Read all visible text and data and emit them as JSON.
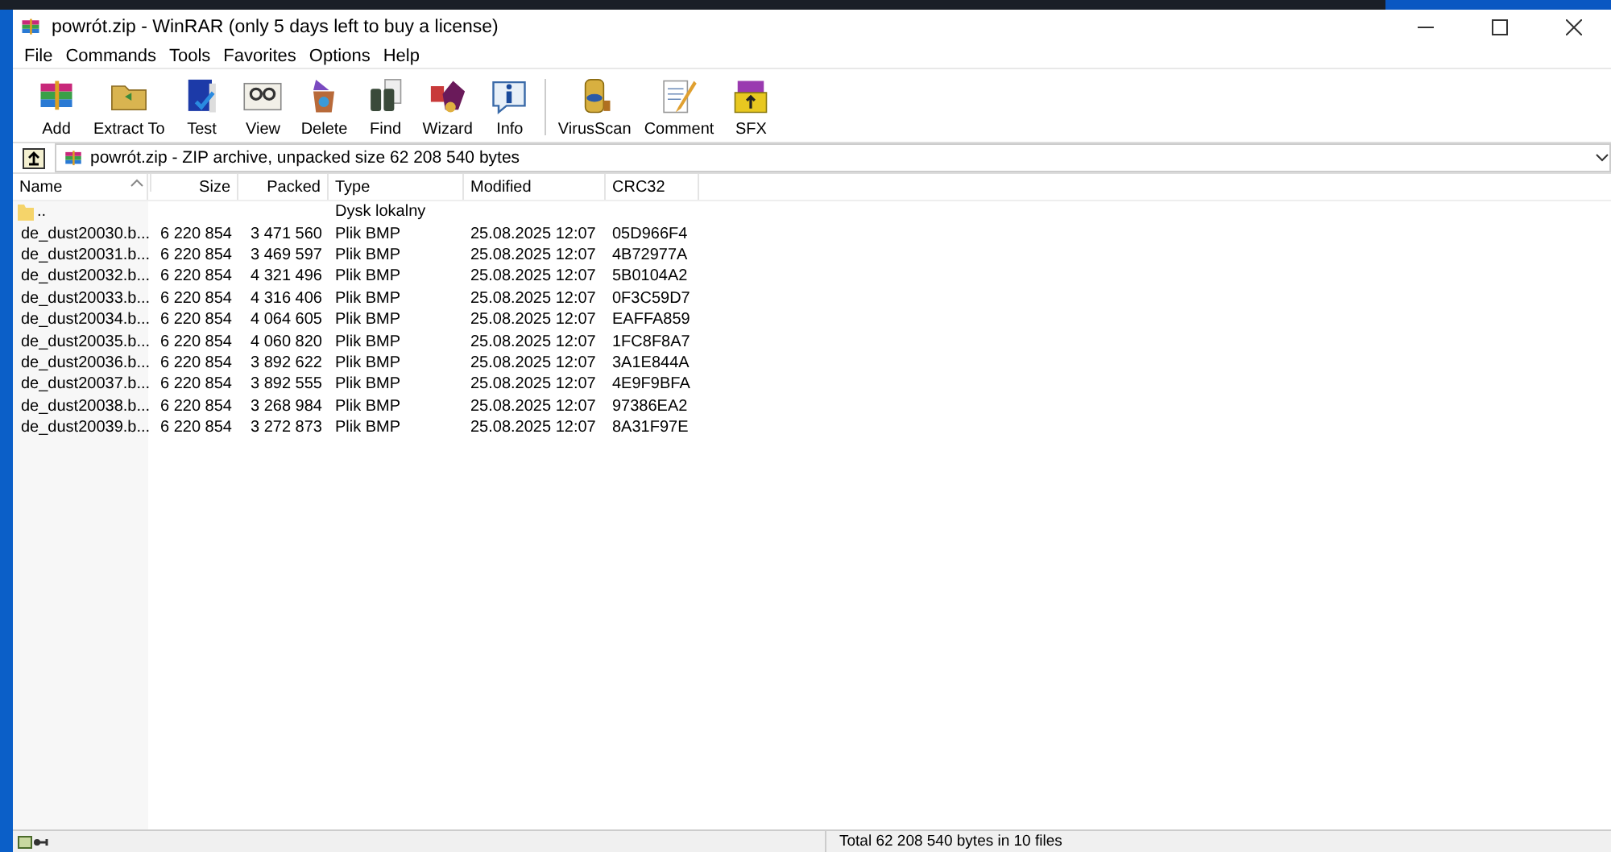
{
  "window": {
    "title": "powrót.zip - WinRAR (only 5 days left to buy a license)"
  },
  "menu": [
    "File",
    "Commands",
    "Tools",
    "Favorites",
    "Options",
    "Help"
  ],
  "toolbar": [
    {
      "label": "Add"
    },
    {
      "label": "Extract To"
    },
    {
      "label": "Test"
    },
    {
      "label": "View"
    },
    {
      "label": "Delete"
    },
    {
      "label": "Find"
    },
    {
      "label": "Wizard"
    },
    {
      "label": "Info"
    },
    {
      "label": "VirusScan",
      "group_start": true
    },
    {
      "label": "Comment"
    },
    {
      "label": "SFX"
    }
  ],
  "address": {
    "text": "powrót.zip - ZIP archive, unpacked size 62 208 540 bytes"
  },
  "table": {
    "columns": [
      {
        "label": "Name",
        "sorted": true
      },
      {
        "label": "Size",
        "sorted": false
      },
      {
        "label": "Packed",
        "sorted": false
      },
      {
        "label": "Type",
        "sorted": false
      },
      {
        "label": "Modified",
        "sorted": false
      },
      {
        "label": "CRC32",
        "sorted": false
      }
    ],
    "rows": [
      {
        "kind": "folder",
        "name": "..",
        "type": "Dysk lokalny"
      },
      {
        "kind": "file",
        "name": "de_dust20030.b...",
        "size": "6 220 854",
        "packed": "3 471 560",
        "type": "Plik BMP",
        "modified": "25.08.2025 12:07",
        "crc32": "05D966F4"
      },
      {
        "kind": "file",
        "name": "de_dust20031.b...",
        "size": "6 220 854",
        "packed": "3 469 597",
        "type": "Plik BMP",
        "modified": "25.08.2025 12:07",
        "crc32": "4B72977A"
      },
      {
        "kind": "file",
        "name": "de_dust20032.b...",
        "size": "6 220 854",
        "packed": "4 321 496",
        "type": "Plik BMP",
        "modified": "25.08.2025 12:07",
        "crc32": "5B0104A2"
      },
      {
        "kind": "file",
        "name": "de_dust20033.b...",
        "size": "6 220 854",
        "packed": "4 316 406",
        "type": "Plik BMP",
        "modified": "25.08.2025 12:07",
        "crc32": "0F3C59D7"
      },
      {
        "kind": "file",
        "name": "de_dust20034.b...",
        "size": "6 220 854",
        "packed": "4 064 605",
        "type": "Plik BMP",
        "modified": "25.08.2025 12:07",
        "crc32": "EAFFA859"
      },
      {
        "kind": "file",
        "name": "de_dust20035.b...",
        "size": "6 220 854",
        "packed": "4 060 820",
        "type": "Plik BMP",
        "modified": "25.08.2025 12:07",
        "crc32": "1FC8F8A7"
      },
      {
        "kind": "file",
        "name": "de_dust20036.b...",
        "size": "6 220 854",
        "packed": "3 892 622",
        "type": "Plik BMP",
        "modified": "25.08.2025 12:07",
        "crc32": "3A1E844A"
      },
      {
        "kind": "file",
        "name": "de_dust20037.b...",
        "size": "6 220 854",
        "packed": "3 892 555",
        "type": "Plik BMP",
        "modified": "25.08.2025 12:07",
        "crc32": "4E9F9BFA"
      },
      {
        "kind": "file",
        "name": "de_dust20038.b...",
        "size": "6 220 854",
        "packed": "3 268 984",
        "type": "Plik BMP",
        "modified": "25.08.2025 12:07",
        "crc32": "97386EA2"
      },
      {
        "kind": "file",
        "name": "de_dust20039.b...",
        "size": "6 220 854",
        "packed": "3 272 873",
        "type": "Plik BMP",
        "modified": "25.08.2025 12:07",
        "crc32": "8A31F97E"
      }
    ]
  },
  "status_bar": {
    "text": "Total 62 208 540 bytes in 10 files"
  }
}
